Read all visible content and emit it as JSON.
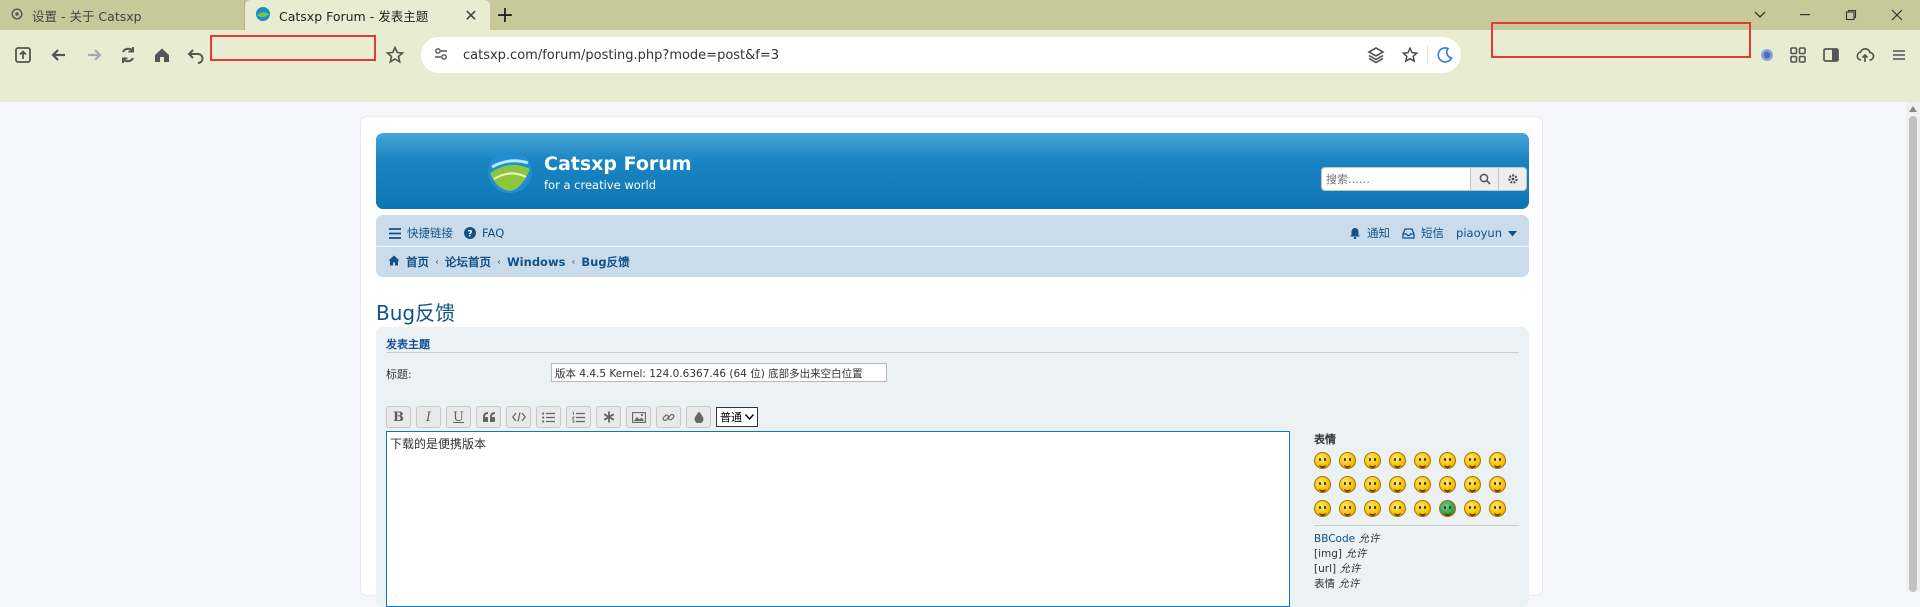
{
  "browser": {
    "tabs": [
      {
        "title": "设置 - 关于 Catsxp",
        "active": false,
        "icon": "gear-icon"
      },
      {
        "title": "Catsxp Forum - 发表主题",
        "active": true,
        "icon": "catsxp-logo-icon"
      }
    ],
    "new_tab": "+",
    "url": "catsxp.com/forum/posting.php?mode=post&f=3",
    "colors": {
      "tabbar": "#c8c89a",
      "toolbar": "#e8ecd0",
      "highlight_box": "#e53935"
    }
  },
  "forum": {
    "site_title": "Catsxp Forum",
    "site_desc": "for a creative world",
    "search_placeholder": "搜索……",
    "nav": {
      "quick_links": "快捷链接",
      "faq": "FAQ",
      "notifications": "通知",
      "messages": "短信",
      "username": "piaoyun"
    },
    "breadcrumbs": [
      "首页",
      "论坛首页",
      "Windows",
      "Bug反馈"
    ],
    "page_title": "Bug反馈",
    "panel_title": "发表主题",
    "subject_label": "标题:",
    "subject_value": "版本 4.4.5 Kernel: 124.0.6367.46 (64 位) 底部多出来空白位置",
    "bbcode_buttons": [
      "B",
      "I",
      "U",
      "quote",
      "code",
      "list",
      "list-numbered",
      "asterisk",
      "image",
      "link",
      "color"
    ],
    "font_size_select": "普通",
    "message_text": "下载的是便携版本",
    "smilies_title": "表情",
    "bbcode_status": [
      {
        "label": "BBCode",
        "status": "允许",
        "is_link": true
      },
      {
        "label": "[img]",
        "status": "允许",
        "is_link": false
      },
      {
        "label": "[url]",
        "status": "允许",
        "is_link": false
      },
      {
        "label": "表情",
        "status": "允许",
        "is_link": false
      }
    ],
    "colors": {
      "header": "#0f76b3",
      "navbar": "#cadceb",
      "link": "#105289",
      "panel": "#ecf1f3"
    }
  }
}
